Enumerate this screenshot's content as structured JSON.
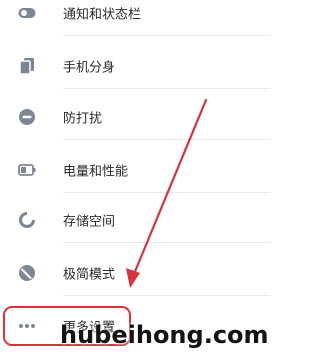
{
  "settings": {
    "items": [
      {
        "label": "通知和状态栏",
        "icon": "toggle-icon"
      },
      {
        "label": "手机分身",
        "icon": "phone-clone-icon"
      },
      {
        "label": "防打扰",
        "icon": "do-not-disturb-icon"
      },
      {
        "label": "电量和性能",
        "icon": "battery-icon"
      },
      {
        "label": "存储空间",
        "icon": "storage-icon"
      },
      {
        "label": "极简模式",
        "icon": "minimal-mode-icon"
      },
      {
        "label": "更多设置",
        "icon": "more-icon"
      }
    ]
  },
  "annotation": {
    "highlight_color": "#d8323c"
  },
  "watermark": {
    "text": "hubeihong.com"
  },
  "colors": {
    "icon": "#7d8694",
    "text": "#2a2a2a",
    "accent_red": "#d8323c"
  }
}
